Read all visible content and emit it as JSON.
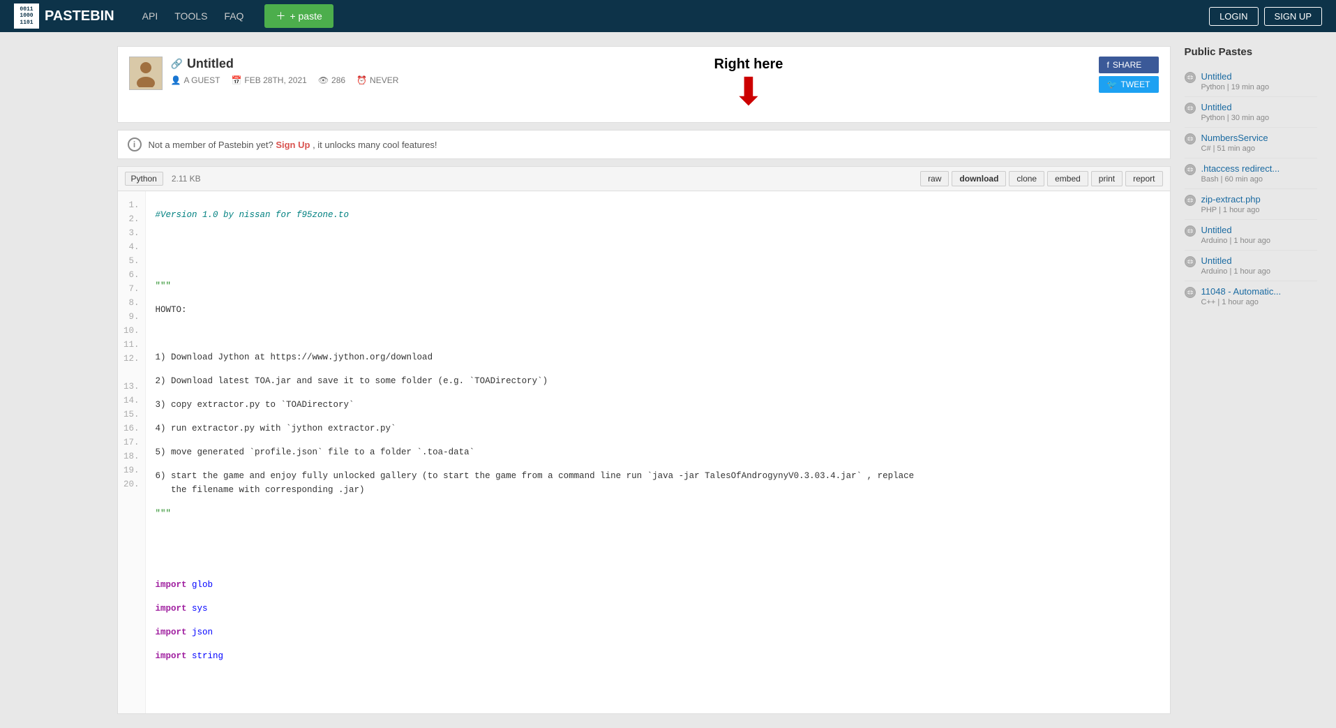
{
  "navbar": {
    "brand_name": "PASTEBIN",
    "brand_logo_text": "0011\n1000\n1101",
    "nav_links": [
      {
        "label": "API",
        "id": "api"
      },
      {
        "label": "TOOLS",
        "id": "tools"
      },
      {
        "label": "FAQ",
        "id": "faq"
      }
    ],
    "paste_button": "+ paste",
    "login_button": "LOGIN",
    "signup_button": "SIGN UP"
  },
  "paste": {
    "title": "Untitled",
    "link_char": "🔗",
    "author": "A GUEST",
    "date": "FEB 28TH, 2021",
    "views": "286",
    "expiry": "NEVER",
    "share_btn": "SHARE",
    "tweet_btn": "TWEET"
  },
  "annotation": {
    "text": "Right here",
    "arrow": "⬇"
  },
  "guest_banner": {
    "message_prefix": "Not a member of Pastebin yet?",
    "signup_link": "Sign Up",
    "message_suffix": ", it unlocks many cool features!"
  },
  "code_toolbar": {
    "language": "Python",
    "file_size": "2.11 KB",
    "actions": [
      "raw",
      "download",
      "clone",
      "embed",
      "print",
      "report"
    ]
  },
  "code_lines": [
    {
      "n": 1,
      "text": "#Version 1.0 by nissan for f95zone.to",
      "type": "comment"
    },
    {
      "n": 2,
      "text": "",
      "type": "empty"
    },
    {
      "n": 3,
      "text": "",
      "type": "empty"
    },
    {
      "n": 4,
      "text": "\"\"\"",
      "type": "string"
    },
    {
      "n": 5,
      "text": "HOWTO:",
      "type": "plain"
    },
    {
      "n": 6,
      "text": "",
      "type": "empty"
    },
    {
      "n": 7,
      "text": "1) Download Jython at https://www.jython.org/download",
      "type": "plain"
    },
    {
      "n": 8,
      "text": "2) Download latest TOA.jar and save it to some folder (e.g. `TOADirectory`)",
      "type": "plain"
    },
    {
      "n": 9,
      "text": "3) copy extractor.py to `TOADirectory`",
      "type": "plain"
    },
    {
      "n": 10,
      "text": "4) run extractor.py with `jython extractor.py`",
      "type": "plain"
    },
    {
      "n": 11,
      "text": "5) move generated `profile.json` file to a folder `.toa-data`",
      "type": "plain"
    },
    {
      "n": 12,
      "text": "6) start the game and enjoy fully unlocked gallery (to start the game from a command line run `java -jar TalesOfAndrogynyV0.3.03.4.jar` , replace\n   the filename with corresponding .jar)",
      "type": "plain"
    },
    {
      "n": 13,
      "text": "\"\"\"",
      "type": "string"
    },
    {
      "n": 14,
      "text": "",
      "type": "empty"
    },
    {
      "n": 15,
      "text": "",
      "type": "empty"
    },
    {
      "n": 16,
      "text": "import glob",
      "type": "import"
    },
    {
      "n": 17,
      "text": "import sys",
      "type": "import"
    },
    {
      "n": 18,
      "text": "import json",
      "type": "import"
    },
    {
      "n": 19,
      "text": "import string",
      "type": "import"
    },
    {
      "n": 20,
      "text": "",
      "type": "empty"
    }
  ],
  "sidebar": {
    "title": "Public Pastes",
    "items": [
      {
        "name": "Untitled",
        "meta": "Python | 19 min ago"
      },
      {
        "name": "Untitled",
        "meta": "Python | 30 min ago"
      },
      {
        "name": "NumbersService",
        "meta": "C# | 51 min ago"
      },
      {
        "name": ".htaccess redirect...",
        "meta": "Bash | 60 min ago"
      },
      {
        "name": "zip-extract.php",
        "meta": "PHP | 1 hour ago"
      },
      {
        "name": "Untitled",
        "meta": "Arduino | 1 hour ago"
      },
      {
        "name": "Untitled",
        "meta": "Arduino | 1 hour ago"
      },
      {
        "name": "11048 - Automatic...",
        "meta": "C++ | 1 hour ago"
      }
    ]
  }
}
